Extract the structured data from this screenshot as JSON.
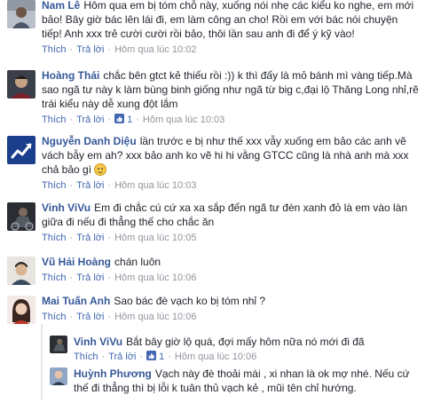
{
  "comments": [
    {
      "name": "Nam Lê",
      "text": "Hôm qua em bị tóm chỗ này, xuống nói nhẹ các kiểu ko nghe, em mới bảo! Bây giờ bác lên lái đi, em làm công an cho! Rồi em với bác nói chuyện tiếp! Anh xxx trẻ cười cười rồi bảo, thôi lần sau anh đi để ý kỹ vào!",
      "like": "Thích",
      "reply": "Trả lời",
      "time": "Hôm qua lúc 10:02"
    },
    {
      "name": "Hoàng Thái",
      "text": "chắc bên gtct kẻ thiếu rồi :)) k thì đấy là mỏ bánh mì vàng tiếp.Mà sao ngã tư này k làm bùng binh giống như ngã từ big c,đại lộ Thăng Long nhỉ,rẽ trái kiểu này dễ xung đột lắm",
      "like": "Thích",
      "reply": "Trả lời",
      "likes": "1",
      "time": "Hôm qua lúc 10:03"
    },
    {
      "name": "Nguyễn Danh Diệu",
      "text": "lần trước e bị như thế xxx vẫy xuống em bảo các anh vẽ vách bẫy em ah? xxx bảo anh ko vẽ hi hi vằng GTCC cũng là nhà anh mà xxx chả bảo gì",
      "like": "Thích",
      "reply": "Trả lời",
      "time": "Hôm qua lúc 10:03"
    },
    {
      "name": "Vinh ViVu",
      "text": "Em đi chắc cú cứ xa xa sắp đến ngã tư đèn xanh đỏ là em vào làn giữa đi nếu đi thẳng thế cho chắc ăn",
      "like": "Thích",
      "reply": "Trả lời",
      "time": "Hôm qua lúc 10:05"
    },
    {
      "name": "Vũ Hải Hoàng",
      "text": "chán luôn",
      "like": "Thích",
      "reply": "Trả lời",
      "time": "Hôm qua lúc 10:06"
    },
    {
      "name": "Mai Tuấn Anh",
      "text": "Sao bác đè vạch ko bị tóm nhỉ ?",
      "like": "Thích",
      "reply": "Trả lời",
      "time": "Hôm qua lúc 10:06"
    }
  ],
  "replies": [
    {
      "name": "Vinh ViVu",
      "text": "Bắt bây giờ lộ quá, đợi mấy hôm nữa nó mới đi đã",
      "like": "Thích",
      "reply": "Trả lời",
      "likes": "1",
      "time": "Hôm qua lúc 10:06"
    },
    {
      "name": "Huỳnh Phương",
      "text": "Vạch này đè thoải mái , xi nhan là ok mợ nhé. Nếu cứ thế đi thẳng thì bị lỗi k tuân thủ vạch kẻ , mũi tên chỉ hướng.",
      "like": "Thích",
      "reply": "Trả lời"
    }
  ],
  "icons": {
    "like": "thumbs-up-icon",
    "emoji": "smile-icon",
    "trend": "trend-up-icon"
  },
  "colors": {
    "name": "#365899",
    "link": "#4267b2",
    "meta": "#90949c",
    "text": "#1d2129"
  }
}
